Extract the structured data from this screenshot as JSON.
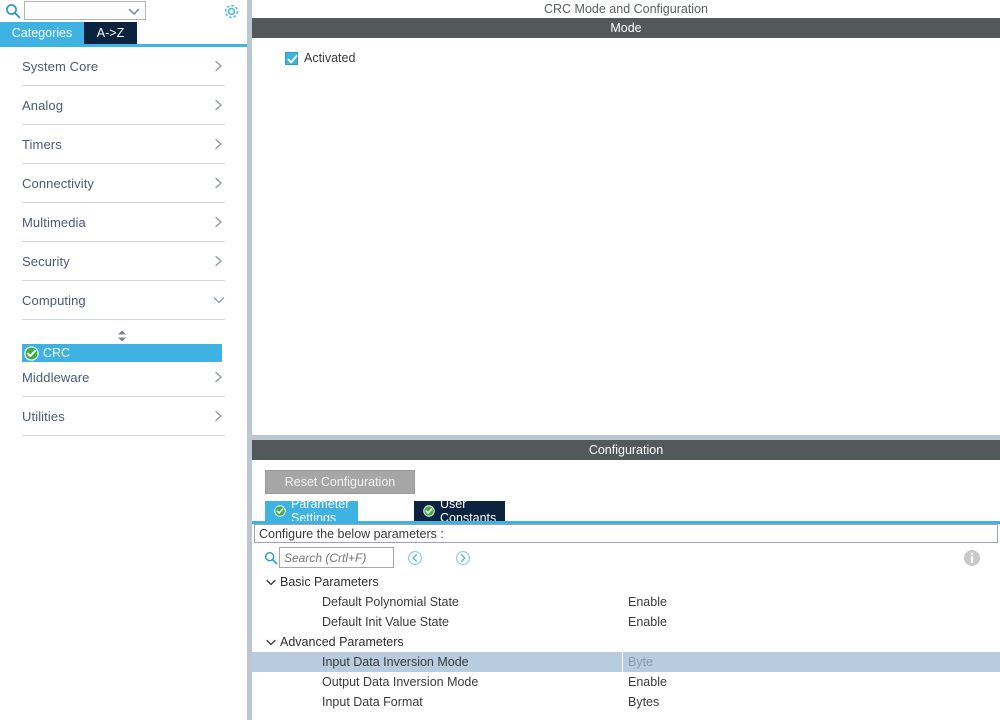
{
  "sidebar": {
    "search": {
      "icon": "search-icon",
      "value": "",
      "placeholder": ""
    },
    "dropdown_icon": "chevron-down-icon",
    "gear_icon": "gear-icon",
    "tabs": [
      {
        "label": "Categories",
        "active": true
      },
      {
        "label": "A->Z",
        "active": false
      }
    ],
    "categories": [
      {
        "label": "System Core",
        "expanded": false,
        "arrow": "chevron-right-icon"
      },
      {
        "label": "Analog",
        "expanded": false,
        "arrow": "chevron-right-icon"
      },
      {
        "label": "Timers",
        "expanded": false,
        "arrow": "chevron-right-icon"
      },
      {
        "label": "Connectivity",
        "expanded": false,
        "arrow": "chevron-right-icon"
      },
      {
        "label": "Multimedia",
        "expanded": false,
        "arrow": "chevron-right-icon"
      },
      {
        "label": "Security",
        "expanded": false,
        "arrow": "chevron-right-icon"
      },
      {
        "label": "Computing",
        "expanded": true,
        "arrow": "chevron-down-icon"
      },
      {
        "label": "Middleware",
        "expanded": false,
        "arrow": "chevron-right-icon"
      },
      {
        "label": "Utilities",
        "expanded": false,
        "arrow": "chevron-right-icon"
      }
    ],
    "selected_peripheral": {
      "label": "CRC",
      "icon": "green-check-circle-icon",
      "spinner_icon": "sort-updown-icon",
      "highlight_color": "#3eb3e3"
    }
  },
  "main": {
    "page_title": "CRC Mode and Configuration",
    "mode": {
      "section_label": "Mode",
      "activated": {
        "label": "Activated",
        "checked": true
      }
    },
    "configuration": {
      "section_label": "Configuration",
      "reset_button": "Reset Configuration",
      "tabs": [
        {
          "label": "Parameter Settings",
          "active": true,
          "icon": "green-check-circle-icon"
        },
        {
          "label": "User Constants",
          "active": false,
          "icon": "green-check-circle-icon"
        }
      ],
      "configure_note": "Configure the below parameters :",
      "search": {
        "icon": "search-icon",
        "placeholder": "Search (Crtl+F)",
        "value": "",
        "prev_icon": "circle-left-arrow-icon",
        "next_icon": "circle-right-arrow-icon"
      },
      "info_icon": "info-circle-icon",
      "groups": [
        {
          "label": "Basic Parameters",
          "expanded": true,
          "twisty": "chevron-down-icon",
          "rows": [
            {
              "name": "Default Polynomial State",
              "value": "Enable",
              "selected": false
            },
            {
              "name": "Default Init Value State",
              "value": "Enable",
              "selected": false
            }
          ]
        },
        {
          "label": "Advanced Parameters",
          "expanded": true,
          "twisty": "chevron-down-icon",
          "rows": [
            {
              "name": "Input Data Inversion Mode",
              "value": "Byte",
              "selected": true
            },
            {
              "name": "Output Data Inversion Mode",
              "value": "Enable",
              "selected": false
            },
            {
              "name": "Input Data Format",
              "value": "Bytes",
              "selected": false
            }
          ]
        }
      ]
    }
  },
  "colors": {
    "accent_blue": "#3eb3e3",
    "dark_navy": "#0c2340",
    "section_gray": "#53585a",
    "selection_row": "#b8cce0",
    "splitter": "#bcc7d3"
  }
}
